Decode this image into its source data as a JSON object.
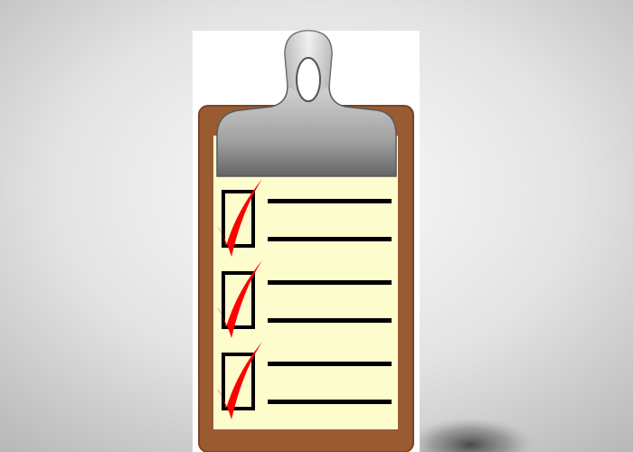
{
  "image": {
    "subject": "clipboard-checklist",
    "background_color_center": "#ffffff",
    "background_color_edge": "#bdbdbd",
    "white_card_color": "#ffffff",
    "board_color": "#9a5a32",
    "board_edge_color": "#7a4424",
    "paper_color": "#fdfccc",
    "clip_color_light": "#f2f2f2",
    "clip_color_dark": "#6a6a6a",
    "checkmark_color": "#ff0000",
    "line_color": "#000000"
  },
  "checklist": {
    "items": [
      {
        "checked": true,
        "icon": "checkmark-icon"
      },
      {
        "checked": true,
        "icon": "checkmark-icon"
      },
      {
        "checked": true,
        "icon": "checkmark-icon"
      }
    ]
  }
}
